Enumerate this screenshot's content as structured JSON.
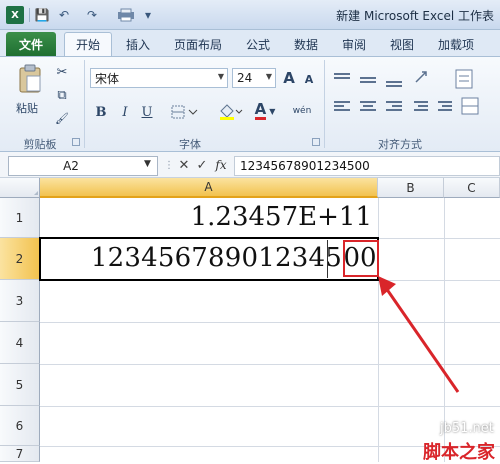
{
  "titlebar": {
    "title": "新建 Microsoft Excel 工作表",
    "logo_glyph": "X",
    "save_glyph": "💾",
    "undo_glyph": "↶",
    "redo_glyph": "↷",
    "customize_glyph": "▾"
  },
  "tabs": {
    "file": "文件",
    "home": "开始",
    "insert": "插入",
    "page_layout": "页面布局",
    "formulas": "公式",
    "data": "数据",
    "review": "审阅",
    "view": "视图",
    "addins": "加载项"
  },
  "ribbon": {
    "clipboard": {
      "label": "剪贴板",
      "paste_label": "粘贴",
      "cut_glyph": "✂",
      "copy_glyph": "⧉",
      "format_painter_glyph": "🖌"
    },
    "font": {
      "label": "字体",
      "font_name": "宋体",
      "font_size": "24",
      "grow_glyph": "A",
      "shrink_glyph": "A",
      "bold": "B",
      "italic": "I",
      "underline": "U",
      "font_color_glyph": "A",
      "phonetic_glyph": "wén"
    },
    "alignment": {
      "label": "对齐方式"
    }
  },
  "formula_bar": {
    "name_box": "A2",
    "cancel_glyph": "✕",
    "enter_glyph": "✓",
    "fx": "fx",
    "content": "12345678901234500"
  },
  "columns": [
    "A",
    "B",
    "C"
  ],
  "rows": [
    "1",
    "2",
    "3",
    "4",
    "5",
    "6",
    "7"
  ],
  "cells": {
    "a1": "1.23457E+11",
    "a2_main": "123456789012345",
    "a2_tail": "00"
  },
  "watermark": {
    "site": "jb51.net",
    "brand": "脚本之家"
  },
  "colors": {
    "highlight_red": "#d9252a",
    "selected_header": "#f7c94a"
  }
}
